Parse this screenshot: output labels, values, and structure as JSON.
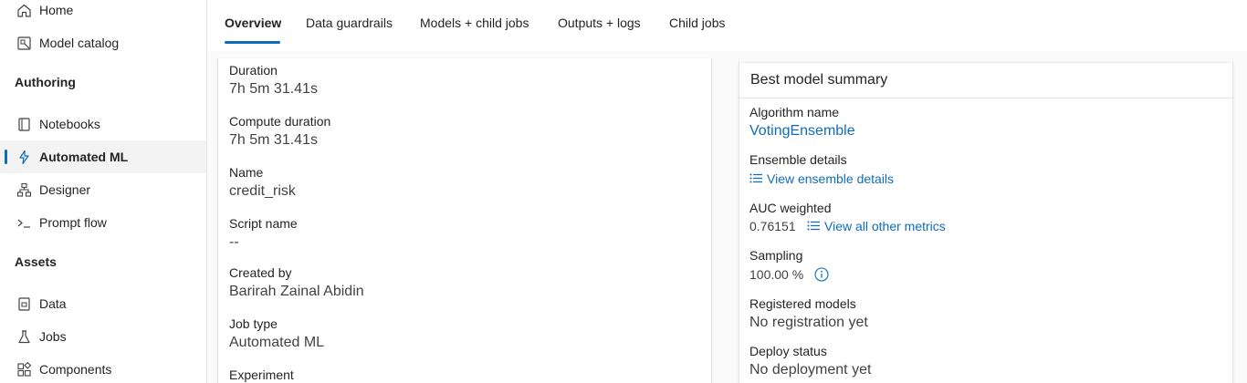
{
  "sidebar": {
    "items": [
      {
        "label": "Home",
        "icon": "home-icon"
      },
      {
        "label": "Model catalog",
        "icon": "catalog-icon"
      },
      {
        "label": "Notebooks",
        "icon": "notebook-icon"
      },
      {
        "label": "Automated ML",
        "icon": "automl-icon",
        "active": true
      },
      {
        "label": "Designer",
        "icon": "designer-icon"
      },
      {
        "label": "Prompt flow",
        "icon": "prompt-flow-icon"
      },
      {
        "label": "Data",
        "icon": "data-icon"
      },
      {
        "label": "Jobs",
        "icon": "jobs-icon"
      },
      {
        "label": "Components",
        "icon": "components-icon"
      }
    ],
    "sections": {
      "authoring": "Authoring",
      "assets": "Assets"
    }
  },
  "tabs": [
    {
      "label": "Overview",
      "active": true
    },
    {
      "label": "Data guardrails"
    },
    {
      "label": "Models + child jobs"
    },
    {
      "label": "Outputs + logs"
    },
    {
      "label": "Child jobs"
    }
  ],
  "properties": {
    "duration_label": "Duration",
    "duration_value": "7h 5m 31.41s",
    "compute_duration_label": "Compute duration",
    "compute_duration_value": "7h 5m 31.41s",
    "name_label": "Name",
    "name_value": "credit_risk",
    "script_name_label": "Script name",
    "script_name_value": "--",
    "created_by_label": "Created by",
    "created_by_value": "Barirah Zainal Abidin",
    "job_type_label": "Job type",
    "job_type_value": "Automated ML",
    "experiment_label": "Experiment"
  },
  "best_model": {
    "title": "Best model summary",
    "algorithm_label": "Algorithm name",
    "algorithm_value": "VotingEnsemble",
    "ensemble_label": "Ensemble details",
    "ensemble_link": "View ensemble details",
    "auc_label": "AUC weighted",
    "auc_value": "0.76151",
    "metrics_link": "View all other metrics",
    "sampling_label": "Sampling",
    "sampling_value": "100.00 %",
    "registered_label": "Registered models",
    "registered_value": "No registration yet",
    "deploy_label": "Deploy status",
    "deploy_value": "No deployment yet"
  },
  "colors": {
    "accent": "#0f6cbd",
    "text": "#242424",
    "muted": "#424242"
  }
}
